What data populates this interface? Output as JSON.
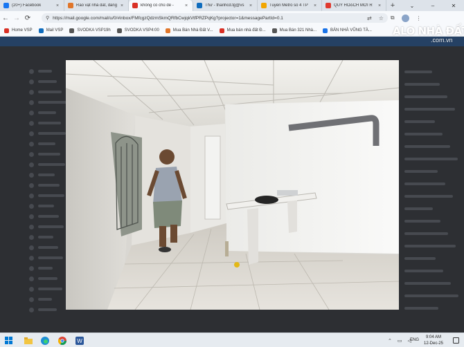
{
  "browser": {
    "tabs": [
      {
        "label": "(20+) Facebook",
        "color": "#1877f2",
        "icon": "facebook-icon",
        "active": false
      },
      {
        "label": "Rao vặt nhà đất, đăng",
        "color": "#e0762a",
        "icon": "home-icon",
        "active": false
      },
      {
        "label": "không có chủ đề - ",
        "color": "#d93025",
        "icon": "gmail-icon",
        "active": true
      },
      {
        "label": "Thư - thanhcd.tg@vs",
        "color": "#0f6cbd",
        "icon": "outlook-icon",
        "active": false
      },
      {
        "label": "Tuyến Metro số 4 TP",
        "color": "#f2a600",
        "icon": "news-icon",
        "active": false
      },
      {
        "label": "QUY HOẠCH MỚI R",
        "color": "#e03a2f",
        "icon": "youtube-icon",
        "active": false
      }
    ],
    "new_tab": "+",
    "url": "https://mail.google.com/mail/u/0/#inbox/FMfcgzQdzmSkmQRfbCwjqkVtfPRZPqKg?projector=1&messagePartId=0.1"
  },
  "bookmarks": [
    {
      "label": "Home VSP",
      "color": "#d93025",
      "icon": "bookmark-icon"
    },
    {
      "label": "Mail VSP",
      "color": "#0f6cbd",
      "icon": "mail-icon"
    },
    {
      "label": "SVODKA VSP19h",
      "color": "#555555",
      "icon": "document-icon"
    },
    {
      "label": "SVODKA VSP4:00",
      "color": "#555555",
      "icon": "document-icon"
    },
    {
      "label": "Mua Bán Nhà Đất V...",
      "color": "#e0762a",
      "icon": "home-icon"
    },
    {
      "label": "Mua bán nhà đất Đ...",
      "color": "#d93025",
      "icon": "bookmark-icon"
    },
    {
      "label": "Mua Bán 321 Nhà...",
      "color": "#555555",
      "icon": "document-icon"
    },
    {
      "label": "BÁN NHÀ VŨNG TÀ...",
      "color": "#1a73e8",
      "icon": "house-icon"
    }
  ],
  "watermark": {
    "logo": "ALO NHÀ ĐẤT",
    "domain": ".com.vn"
  },
  "taskbar": {
    "language": "ENG",
    "time": "9:04 AM",
    "date": "12-Dec-25",
    "apps": [
      "windows-icon",
      "file-explorer-icon",
      "edge-icon",
      "chrome-icon",
      "word-icon"
    ]
  }
}
